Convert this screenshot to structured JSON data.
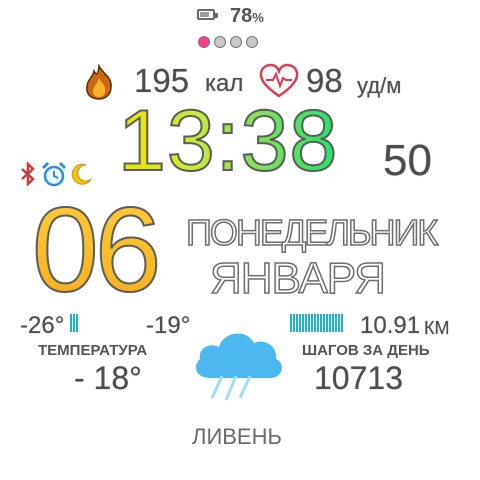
{
  "battery": {
    "percent_text": "78",
    "percent_sign": "%",
    "level": 0.78
  },
  "page_dots": [
    {
      "color": "#ff3d8b"
    },
    {
      "color": "#c8c8c8"
    },
    {
      "color": "#c8c8c8"
    },
    {
      "color": "#c8c8c8"
    },
    {
      "color": "#c8c8c8"
    }
  ],
  "health": {
    "calories_value": "195",
    "calories_unit": "кал",
    "heart_value": "98",
    "heart_unit": "уд/м"
  },
  "time": {
    "hours": "13",
    "separator": ":",
    "minutes": "38",
    "seconds": "50"
  },
  "status_icons": [
    "bluetooth-icon",
    "alarm-icon",
    "moon-icon"
  ],
  "date": {
    "day": "06",
    "weekday": "ПОНЕДЕЛЬНИК",
    "month": "ЯНВАРЯ"
  },
  "weather": {
    "low": "-26°",
    "high": "-19°",
    "temp_label": "ТЕМПЕРАТУРА",
    "temp_current": "- 18°",
    "condition": "ЛИВЕНЬ",
    "icon": "rain-cloud-icon"
  },
  "activity": {
    "distance_value": "10.91",
    "distance_unit": "КМ",
    "steps_label": "ШАГОВ ЗА ДЕНЬ",
    "steps_value": "10713",
    "steps_progress": 1.0
  },
  "colors": {
    "accent_pink": "#ff3d8b",
    "time_gradient_start": "#f0e400",
    "time_gradient_end": "#1ee56a",
    "day_color": "#f7ad1a",
    "bar_color": "#1db5c8",
    "rain_cloud": "#4bb8f0"
  }
}
